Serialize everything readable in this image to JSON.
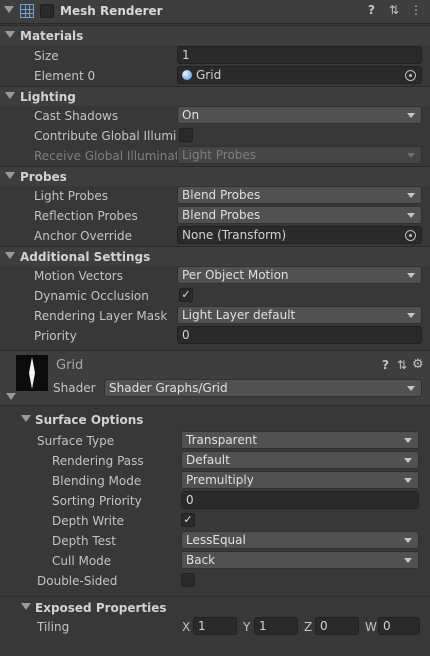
{
  "component": {
    "title": "Mesh Renderer",
    "header_icons": {
      "help": "?",
      "presets": "⇅",
      "menu": "⋮"
    }
  },
  "materials": {
    "title": "Materials",
    "size_label": "Size",
    "size_value": "1",
    "element0_label": "Element 0",
    "element0_value": "Grid"
  },
  "lighting": {
    "title": "Lighting",
    "cast_shadows_label": "Cast Shadows",
    "cast_shadows_value": "On",
    "contribute_gi_label": "Contribute Global Illumina",
    "contribute_gi_checked": false,
    "receive_gi_label": "Receive Global Illuminatio",
    "receive_gi_value": "Light Probes"
  },
  "probes": {
    "title": "Probes",
    "light_probes_label": "Light Probes",
    "light_probes_value": "Blend Probes",
    "reflection_probes_label": "Reflection Probes",
    "reflection_probes_value": "Blend Probes",
    "anchor_override_label": "Anchor Override",
    "anchor_override_value": "None (Transform)"
  },
  "additional": {
    "title": "Additional Settings",
    "motion_vectors_label": "Motion Vectors",
    "motion_vectors_value": "Per Object Motion",
    "dynamic_occlusion_label": "Dynamic Occlusion",
    "dynamic_occlusion_checked": "✓",
    "rendering_layer_label": "Rendering Layer Mask",
    "rendering_layer_value": "Light Layer default",
    "priority_label": "Priority",
    "priority_value": "0"
  },
  "material": {
    "name": "Grid",
    "shader_label": "Shader",
    "shader_value": "Shader Graphs/Grid"
  },
  "surface": {
    "title": "Surface Options",
    "surface_type_label": "Surface Type",
    "surface_type_value": "Transparent",
    "rendering_pass_label": "Rendering Pass",
    "rendering_pass_value": "Default",
    "blending_mode_label": "Blending Mode",
    "blending_mode_value": "Premultiply",
    "sorting_priority_label": "Sorting Priority",
    "sorting_priority_value": "0",
    "depth_write_label": "Depth Write",
    "depth_write_checked": "✓",
    "depth_test_label": "Depth Test",
    "depth_test_value": "LessEqual",
    "cull_mode_label": "Cull Mode",
    "cull_mode_value": "Back",
    "double_sided_label": "Double-Sided",
    "double_sided_checked": false
  },
  "exposed": {
    "title": "Exposed Properties",
    "tiling_label": "Tiling",
    "x_label": "X",
    "x_value": "1",
    "y_label": "Y",
    "y_value": "1",
    "z_label": "Z",
    "z_value": "0",
    "w_label": "W",
    "w_value": "0"
  },
  "colors": {
    "background": "#383838",
    "field": "#2a2a2a",
    "dropdown": "#515151",
    "header": "#3e3e3e"
  }
}
